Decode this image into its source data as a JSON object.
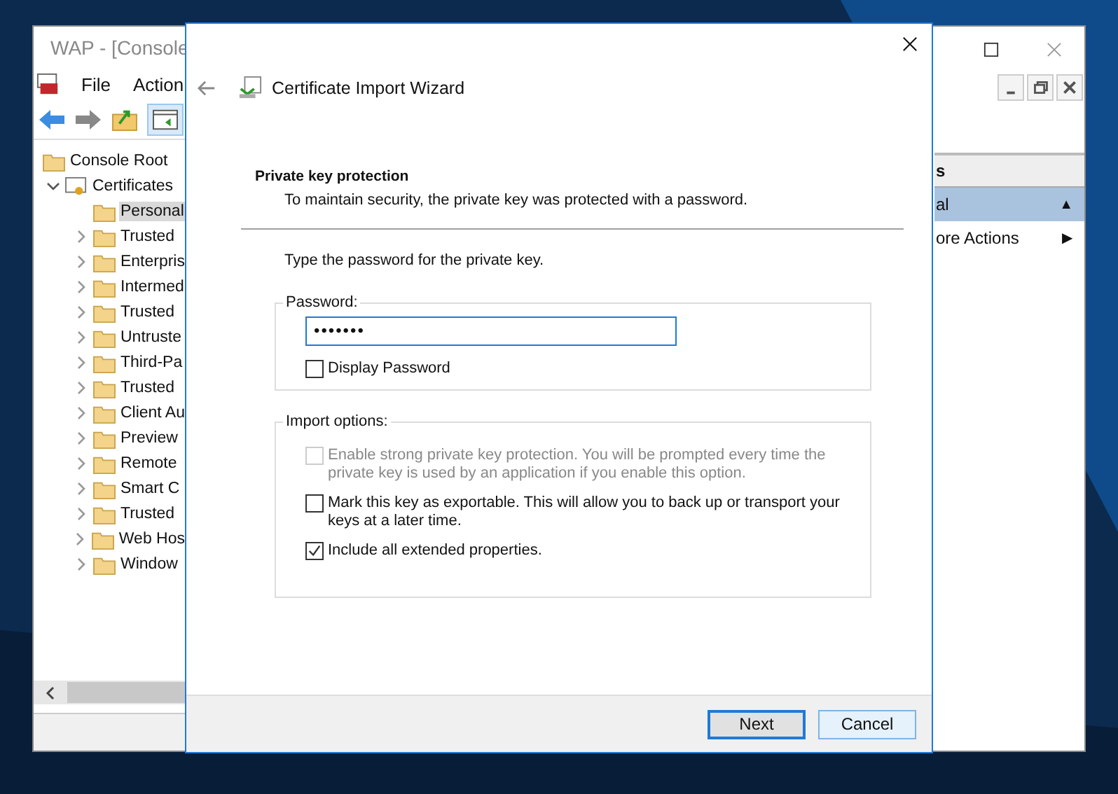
{
  "console_window": {
    "title": "WAP - [Console",
    "menu": [
      "File",
      "Action"
    ],
    "tree": [
      {
        "label": "Console Root",
        "children": [
          {
            "label": "Certificates",
            "expanded": true,
            "selected": false,
            "children": [
              {
                "label": "Personal",
                "selected": true,
                "expandable": false
              },
              {
                "label": "Trusted",
                "selected": false,
                "expandable": true
              },
              {
                "label": "Enterpris",
                "selected": false,
                "expandable": true
              },
              {
                "label": "Intermed",
                "selected": false,
                "expandable": true
              },
              {
                "label": "Trusted",
                "selected": false,
                "expandable": true
              },
              {
                "label": "Untruste",
                "selected": false,
                "expandable": true
              },
              {
                "label": "Third-Pa",
                "selected": false,
                "expandable": true
              },
              {
                "label": "Trusted",
                "selected": false,
                "expandable": true
              },
              {
                "label": "Client Au",
                "selected": false,
                "expandable": true
              },
              {
                "label": "Preview",
                "selected": false,
                "expandable": true
              },
              {
                "label": "Remote",
                "selected": false,
                "expandable": true
              },
              {
                "label": "Smart C",
                "selected": false,
                "expandable": true
              },
              {
                "label": "Trusted",
                "selected": false,
                "expandable": true
              },
              {
                "label": "Web Hos",
                "selected": false,
                "expandable": true
              },
              {
                "label": "Window",
                "selected": false,
                "expandable": true
              }
            ]
          }
        ]
      }
    ],
    "actions": {
      "header": "s",
      "items": [
        {
          "label": "al",
          "selected": true,
          "arrow": "▲"
        },
        {
          "label": "ore Actions",
          "selected": false,
          "arrow": "▶"
        }
      ]
    }
  },
  "dialog": {
    "title": "Certificate Import Wizard",
    "heading": "Private key protection",
    "subtitle": "To maintain security, the private key was protected with a password.",
    "prompt": "Type the password for the private key.",
    "password_group": {
      "label": "Password:",
      "value": "•••••••",
      "show_password": {
        "label": "Display Password",
        "checked": false
      }
    },
    "import_options": {
      "label": "Import options:",
      "options": [
        {
          "label": "Enable strong private key protection. You will be prompted every time the private key is used by an application if you enable this option.",
          "checked": false,
          "disabled": true
        },
        {
          "label": "Mark this key as exportable. This will allow you to back up or transport your keys at a later time.",
          "checked": false,
          "disabled": false
        },
        {
          "label": "Include all extended properties.",
          "checked": true,
          "disabled": false
        }
      ]
    },
    "buttons": [
      {
        "label": "Next",
        "default": true
      },
      {
        "label": "Cancel",
        "default": false
      }
    ]
  }
}
